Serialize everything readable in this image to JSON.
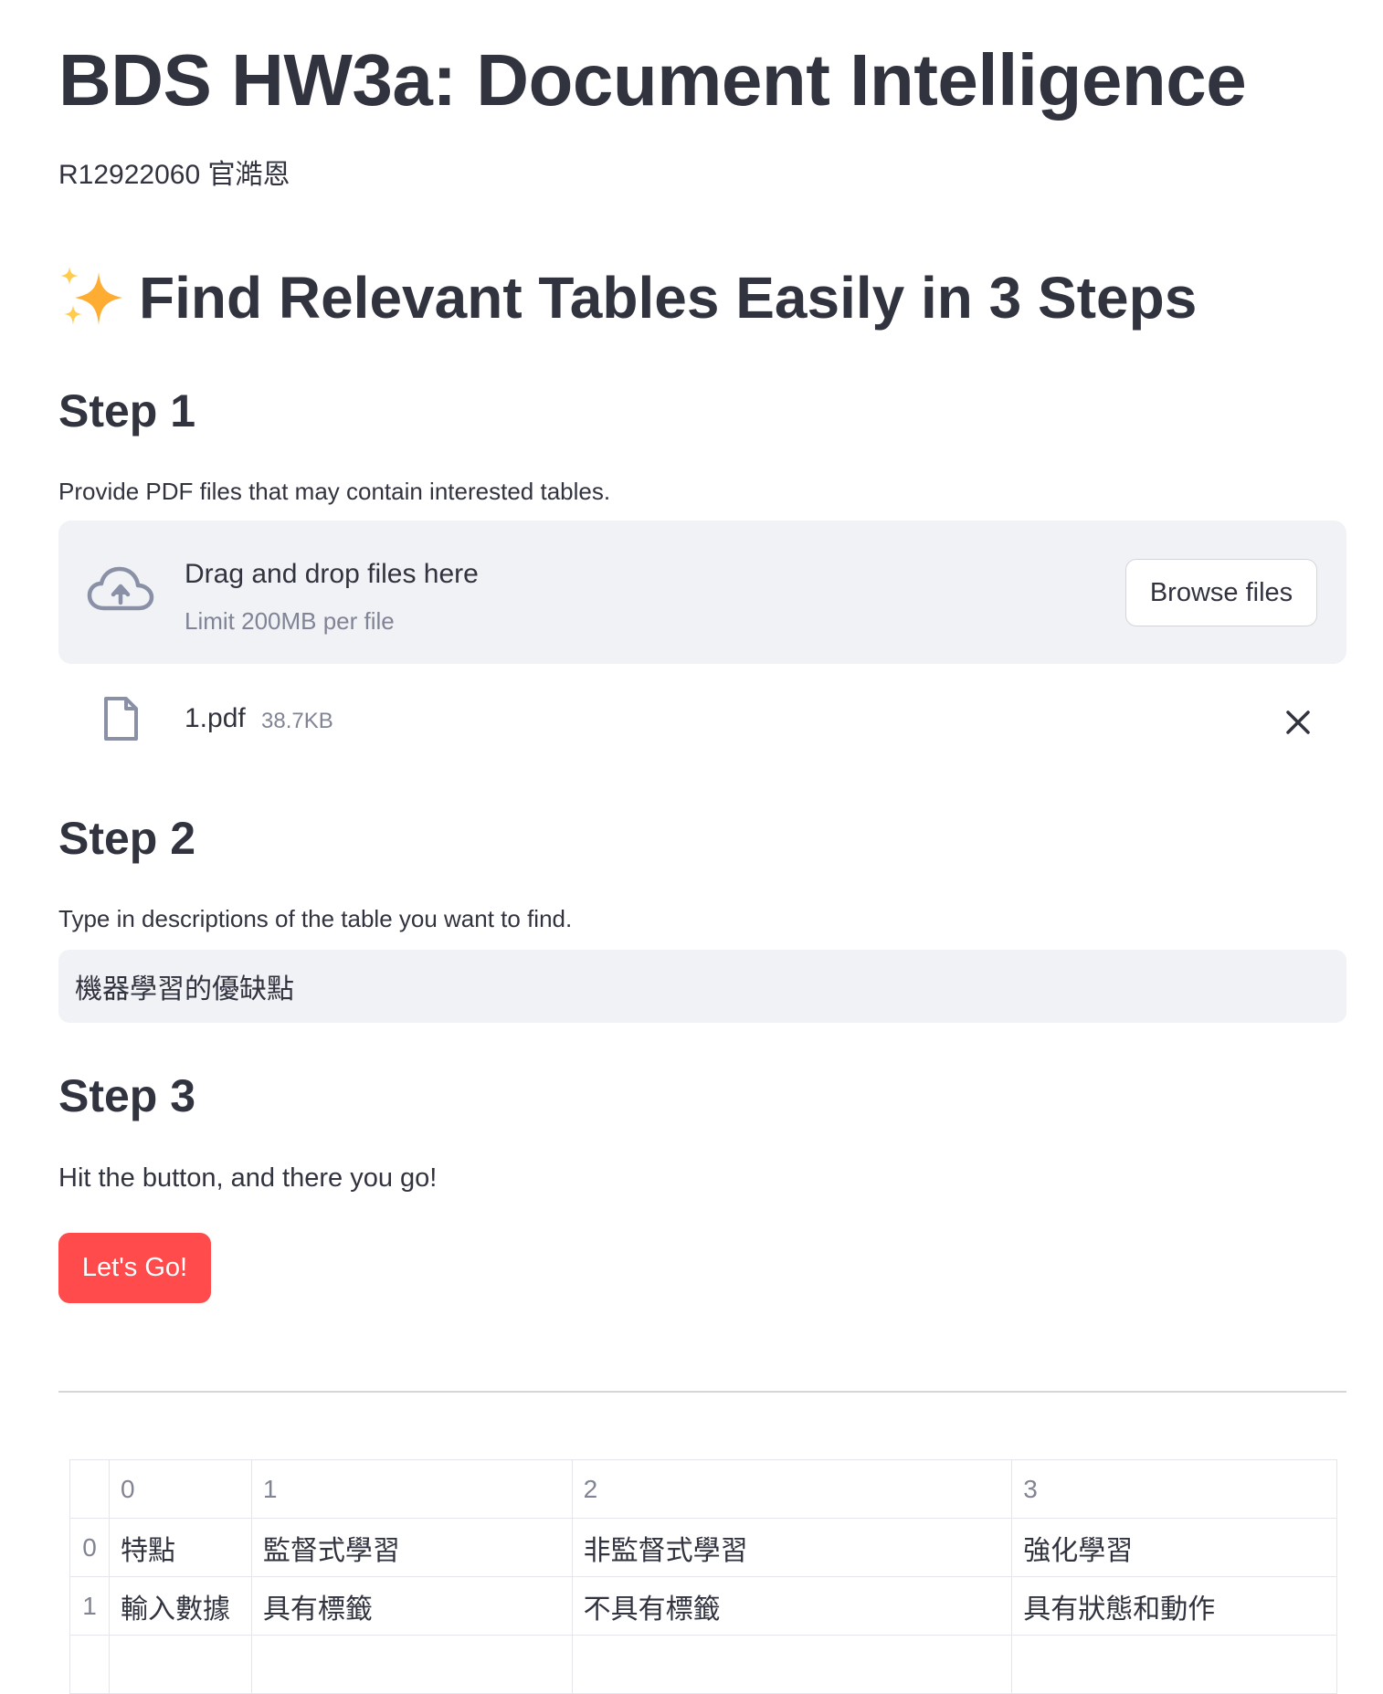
{
  "header": {
    "title": "BDS HW3a: Document Intelligence",
    "author": "R12922060 官澔恩"
  },
  "subtitle": {
    "icon": "sparkles-icon",
    "text": "Find Relevant Tables Easily in 3 Steps"
  },
  "step1": {
    "heading": "Step 1",
    "description": "Provide PDF files that may contain interested tables.",
    "uploader": {
      "drop_label": "Drag and drop files here",
      "limit": "Limit 200MB per file",
      "browse_label": "Browse files"
    },
    "file": {
      "name": "1.pdf",
      "size": "38.7KB"
    }
  },
  "step2": {
    "heading": "Step 2",
    "description": "Type in descriptions of the table you want to find.",
    "query_value": "機器學習的優缺點"
  },
  "step3": {
    "heading": "Step 3",
    "description": "Hit the button, and there you go!",
    "button_label": "Let's Go!"
  },
  "colors": {
    "text": "#31333f",
    "muted": "#808495",
    "panel_bg": "#f0f2f6",
    "primary": "#ff4b4b"
  },
  "result_table": {
    "columns": [
      "",
      "0",
      "1",
      "2",
      "3"
    ],
    "rows": [
      {
        "index": "0",
        "cells": [
          "特點",
          "監督式學習",
          "非監督式學習",
          "強化學習"
        ]
      },
      {
        "index": "1",
        "cells": [
          "輸入數據",
          "具有標籤",
          "不具有標籤",
          "具有狀態和動作"
        ]
      }
    ]
  }
}
